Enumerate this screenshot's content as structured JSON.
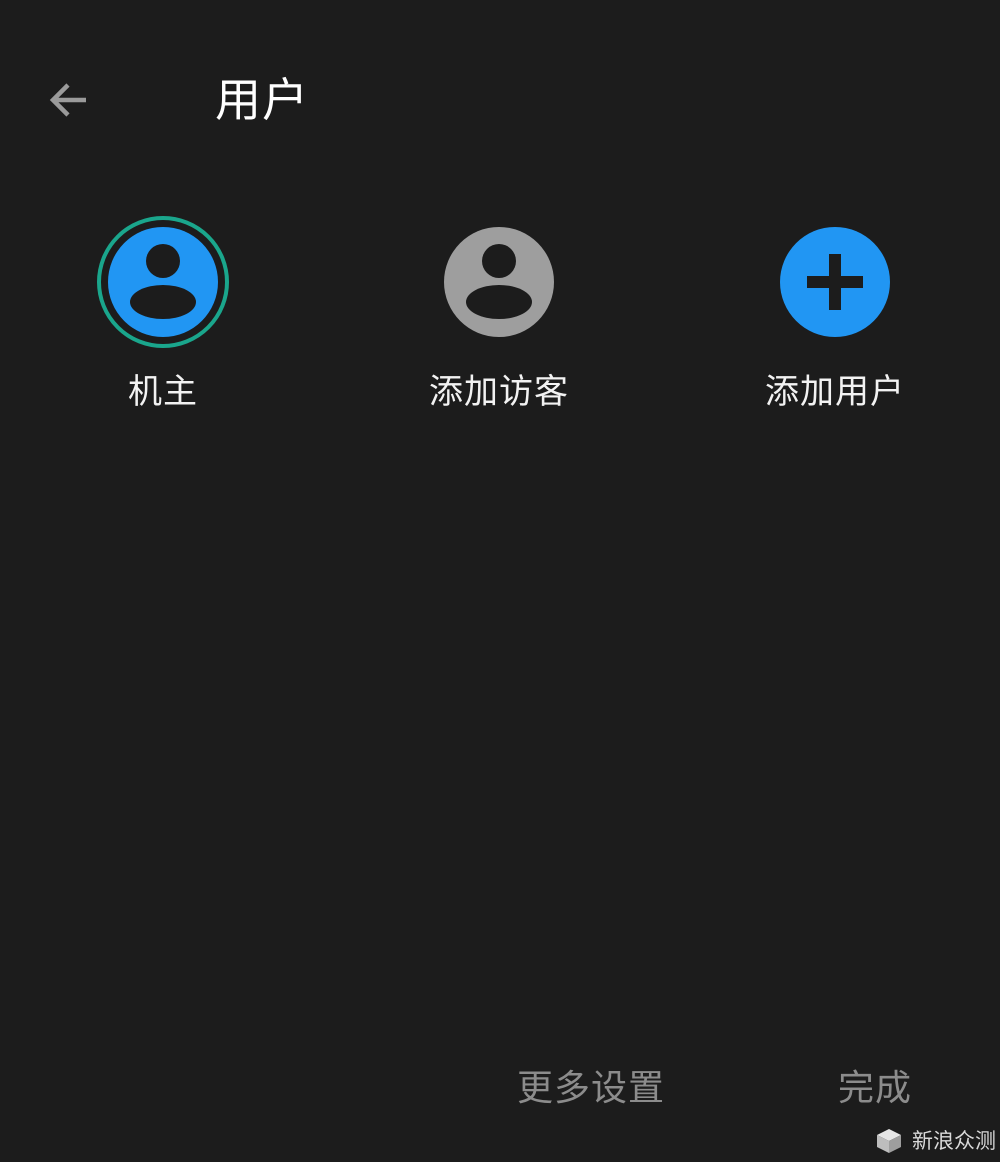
{
  "header": {
    "title": "用户",
    "back_icon": "arrow-left-icon"
  },
  "users": [
    {
      "label": "机主",
      "icon": "person-icon",
      "avatar_color": "#2196f3",
      "selected": true,
      "ring_color": "#1aa68c"
    },
    {
      "label": "添加访客",
      "icon": "person-icon",
      "avatar_color": "#9e9e9e",
      "selected": false
    },
    {
      "label": "添加用户",
      "icon": "plus-icon",
      "avatar_color": "#2196f3",
      "selected": false
    }
  ],
  "footer": {
    "more_settings_label": "更多设置",
    "done_label": "完成"
  },
  "watermark": {
    "text": "新浪众测"
  },
  "colors": {
    "background": "#1c1c1c",
    "accent": "#2196f3",
    "muted_text": "#8c8c8c"
  }
}
